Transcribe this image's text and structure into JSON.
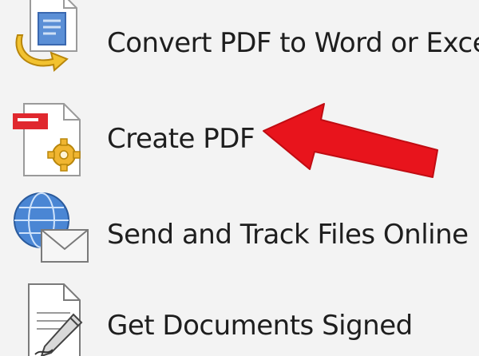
{
  "menu": {
    "items": [
      {
        "label": "Convert PDF to Word or Excel",
        "icon": "convert-pdf-icon"
      },
      {
        "label": "Create PDF",
        "icon": "create-pdf-icon"
      },
      {
        "label": "Send and Track Files Online",
        "icon": "globe-envelope-icon"
      },
      {
        "label": "Get Documents Signed",
        "icon": "sign-document-icon"
      }
    ]
  },
  "annotation": {
    "arrow_color": "#e8141c",
    "points_to": "Create PDF"
  },
  "colors": {
    "background": "#f3f3f3",
    "text": "#1e1e1e"
  }
}
